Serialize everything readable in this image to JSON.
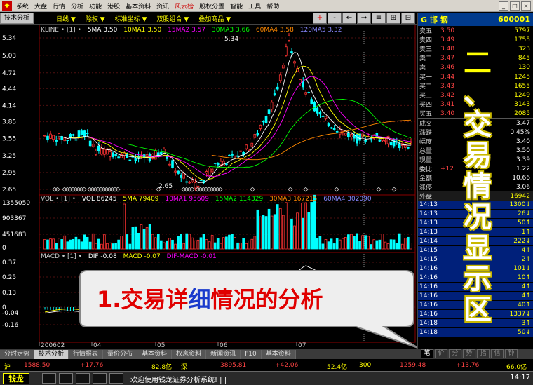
{
  "menu": {
    "items": [
      "系统",
      "大盘",
      "行情",
      "分析",
      "功能",
      "港股",
      "基本资料",
      "资讯",
      "风云榜",
      "股权分置",
      "智能",
      "工具",
      "帮助"
    ],
    "highlight_index": 8,
    "window_buttons": [
      "_",
      "□",
      "×"
    ]
  },
  "toolbar": {
    "tab_label": "技术分析",
    "period": "日线 ▼",
    "fq": "除权 ▼",
    "coord": "标准坐标 ▼",
    "overlay": "双股组合 ▼",
    "extra": "叠加商品 ▼",
    "buttons": [
      "+",
      "-",
      "←",
      "→",
      "≡",
      "⊞",
      "⊟"
    ]
  },
  "kline": {
    "legend": {
      "name": "KLINE • [1] •",
      "ma5": "5MA 3.50",
      "ma10": "10MA1 3.50",
      "ma15": "15MA2 3.57",
      "ma30": "30MA3 3.66",
      "ma60": "60MA4 3.58",
      "ma120": "120MA5 3.32"
    },
    "ylabels": [
      "5.34",
      "5.03",
      "4.72",
      "4.44",
      "4.14",
      "3.85",
      "3.55",
      "3.25",
      "2.95",
      "2.65"
    ],
    "high_label": "5.34",
    "low_label": "2.65"
  },
  "vol": {
    "legend": {
      "name": "VOL • [1] •",
      "vol": "VOL 86245",
      "ma5": "5MA 79409",
      "ma10": "10MA1 95609",
      "ma15": "15MA2 114329",
      "ma30": "30MA3 167215",
      "ma60": "60MA4 302090"
    },
    "ylabels": [
      "1355050",
      "903367",
      "451683",
      "0"
    ]
  },
  "macd": {
    "legend": {
      "name": "MACD • [1] •",
      "dif": "DIF -0.08",
      "macd": "MACD -0.07",
      "difmacd": "DIF-MACD -0.01"
    },
    "ylabels": [
      "0.37",
      "0.25",
      "0.13",
      "0",
      "-0.04",
      "-0.16"
    ]
  },
  "xaxis": {
    "labels": [
      "200602",
      "04",
      "05",
      "06",
      "07"
    ]
  },
  "callout": {
    "prefix": "1.交易详",
    "mid": "细",
    "suffix": "情况的分析"
  },
  "quote": {
    "stock_name": "G 邯 钢",
    "stock_code": "600001",
    "sells": [
      {
        "label": "卖五",
        "price": "3.50",
        "vol": "5797"
      },
      {
        "label": "卖四",
        "price": "3.49",
        "vol": "1755"
      },
      {
        "label": "卖三",
        "price": "3.48",
        "vol": "323"
      },
      {
        "label": "卖二",
        "price": "3.47",
        "vol": "845"
      },
      {
        "label": "卖一",
        "price": "3.46",
        "vol": "130"
      }
    ],
    "buys": [
      {
        "label": "买一",
        "price": "3.44",
        "vol": "1245"
      },
      {
        "label": "买二",
        "price": "3.43",
        "vol": "1655"
      },
      {
        "label": "买三",
        "price": "3.42",
        "vol": "1249"
      },
      {
        "label": "买四",
        "price": "3.41",
        "vol": "3143"
      },
      {
        "label": "买五",
        "price": "3.40",
        "vol": "2085"
      }
    ],
    "stats": [
      {
        "label": "成交",
        "vol": "3.47"
      },
      {
        "label": "涨跌",
        "vol": "0.45%"
      },
      {
        "label": "幅度",
        "vol": "3.40"
      },
      {
        "label": "总量",
        "vol": "3.50"
      },
      {
        "label": "现量",
        "vol": "3.39"
      },
      {
        "label": "委比",
        "price": "+12",
        "vol": "1.22"
      },
      {
        "label": "金额",
        "vol": "10.66"
      },
      {
        "label": "涨停",
        "vol": "3.06"
      }
    ],
    "outer": {
      "label": "外盘",
      "vol": "16942"
    },
    "ticks": [
      {
        "time": "14:13",
        "vol": "1300↓"
      },
      {
        "time": "14:13",
        "vol": "26↓"
      },
      {
        "time": "14:13",
        "vol": "50↑"
      },
      {
        "time": "14:13",
        "vol": "1↑"
      },
      {
        "time": "14:14",
        "vol": "222↓"
      },
      {
        "time": "14:15",
        "vol": "4↑"
      },
      {
        "time": "14:15",
        "vol": "2↑"
      },
      {
        "time": "14:16",
        "vol": "101↓"
      },
      {
        "time": "14:16",
        "vol": "10↑"
      },
      {
        "time": "14:16",
        "vol": "4↑"
      },
      {
        "time": "14:16",
        "vol": "4↑"
      },
      {
        "time": "14:16",
        "vol": "40↑"
      },
      {
        "time": "14:16",
        "vol": "1337↓"
      },
      {
        "time": "14:18",
        "vol": "3↑"
      },
      {
        "time": "14:18",
        "vol": "50↓"
      }
    ]
  },
  "side_title": [
    "二",
    "、",
    "交",
    "易",
    "情",
    "况",
    "显",
    "示",
    "区"
  ],
  "bottom_tabs": [
    "分时走势",
    "技术分析",
    "行情报表",
    "量价分布",
    "基本资料",
    "权息资料",
    "新闻资讯",
    "F10",
    "基本资料"
  ],
  "bottom_active": 1,
  "right_tabs": [
    "笔",
    "价",
    "分",
    "势",
    "指",
    "信",
    "钟"
  ],
  "indexbar": {
    "sh_label": "沪",
    "sh_val": "1588.50",
    "sh_chg": "+17.76",
    "sh_amt": "82.8亿",
    "sz_label": "深",
    "sz_val": "3895.81",
    "sz_chg": "+42.06",
    "sz_amt": "52.4亿",
    "i300_label": "300",
    "i300_val": "1259.48",
    "i300_chg": "+13.76",
    "i300_amt": "66.0亿"
  },
  "status": {
    "logo": "钱龙",
    "message": "欢迎使用钱龙证券分析系统! | |",
    "clock": "14:17"
  },
  "colors": {
    "up": "#ff3333",
    "down": "#00ffff",
    "ma5": "#ffffff",
    "ma10": "#ffff00",
    "ma15": "#ff00ff",
    "ma30": "#00ff00",
    "ma60": "#ff8800",
    "ma120": "#8080ff"
  }
}
